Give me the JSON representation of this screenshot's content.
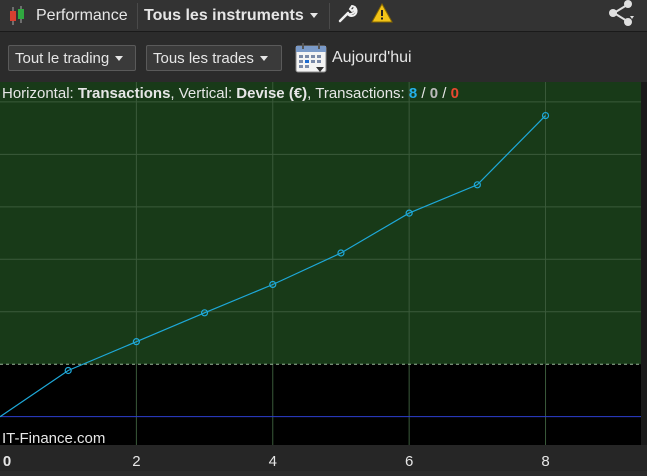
{
  "toolbar": {
    "performance_label": "Performance",
    "instruments_label": "Tous les instruments"
  },
  "filters": {
    "trading_label": "Tout le trading",
    "trades_label": "Tous les trades",
    "date_label": "Aujourd'hui"
  },
  "chart_header": {
    "horizontal_prefix": "Horizontal: ",
    "horizontal_value": "Transactions",
    "vertical_prefix": ", Vertical: ",
    "vertical_value": "Devise (€)",
    "transactions_prefix": ", Transactions: ",
    "count_total": "8",
    "slash1": " / ",
    "count_mid": "0",
    "slash2": " / ",
    "count_loss": "0"
  },
  "watermark": "IT-Finance.com",
  "colors": {
    "profit_area": "#183a18",
    "loss_area": "#000000",
    "line": "#1ea8d8",
    "baseline": "#2d3fd0",
    "count_total": "#25b0e8",
    "count_mid": "#bbbbbb",
    "count_loss": "#e84830"
  },
  "chart_data": {
    "type": "line",
    "x": [
      0,
      1,
      2,
      3,
      4,
      5,
      6,
      7,
      8
    ],
    "y": [
      0,
      8.8,
      14.3,
      19.8,
      25.2,
      31.2,
      38.8,
      44.2,
      57.4
    ],
    "xlim": [
      0,
      9.4
    ],
    "ylim": [
      -5.4,
      63.8
    ],
    "x_ticks": [
      "0",
      "2",
      "4",
      "6",
      "8"
    ],
    "xlabel": "Transactions",
    "ylabel": "Devise (€)",
    "grid": true,
    "zero_line": 0,
    "threshold_line": 10
  }
}
